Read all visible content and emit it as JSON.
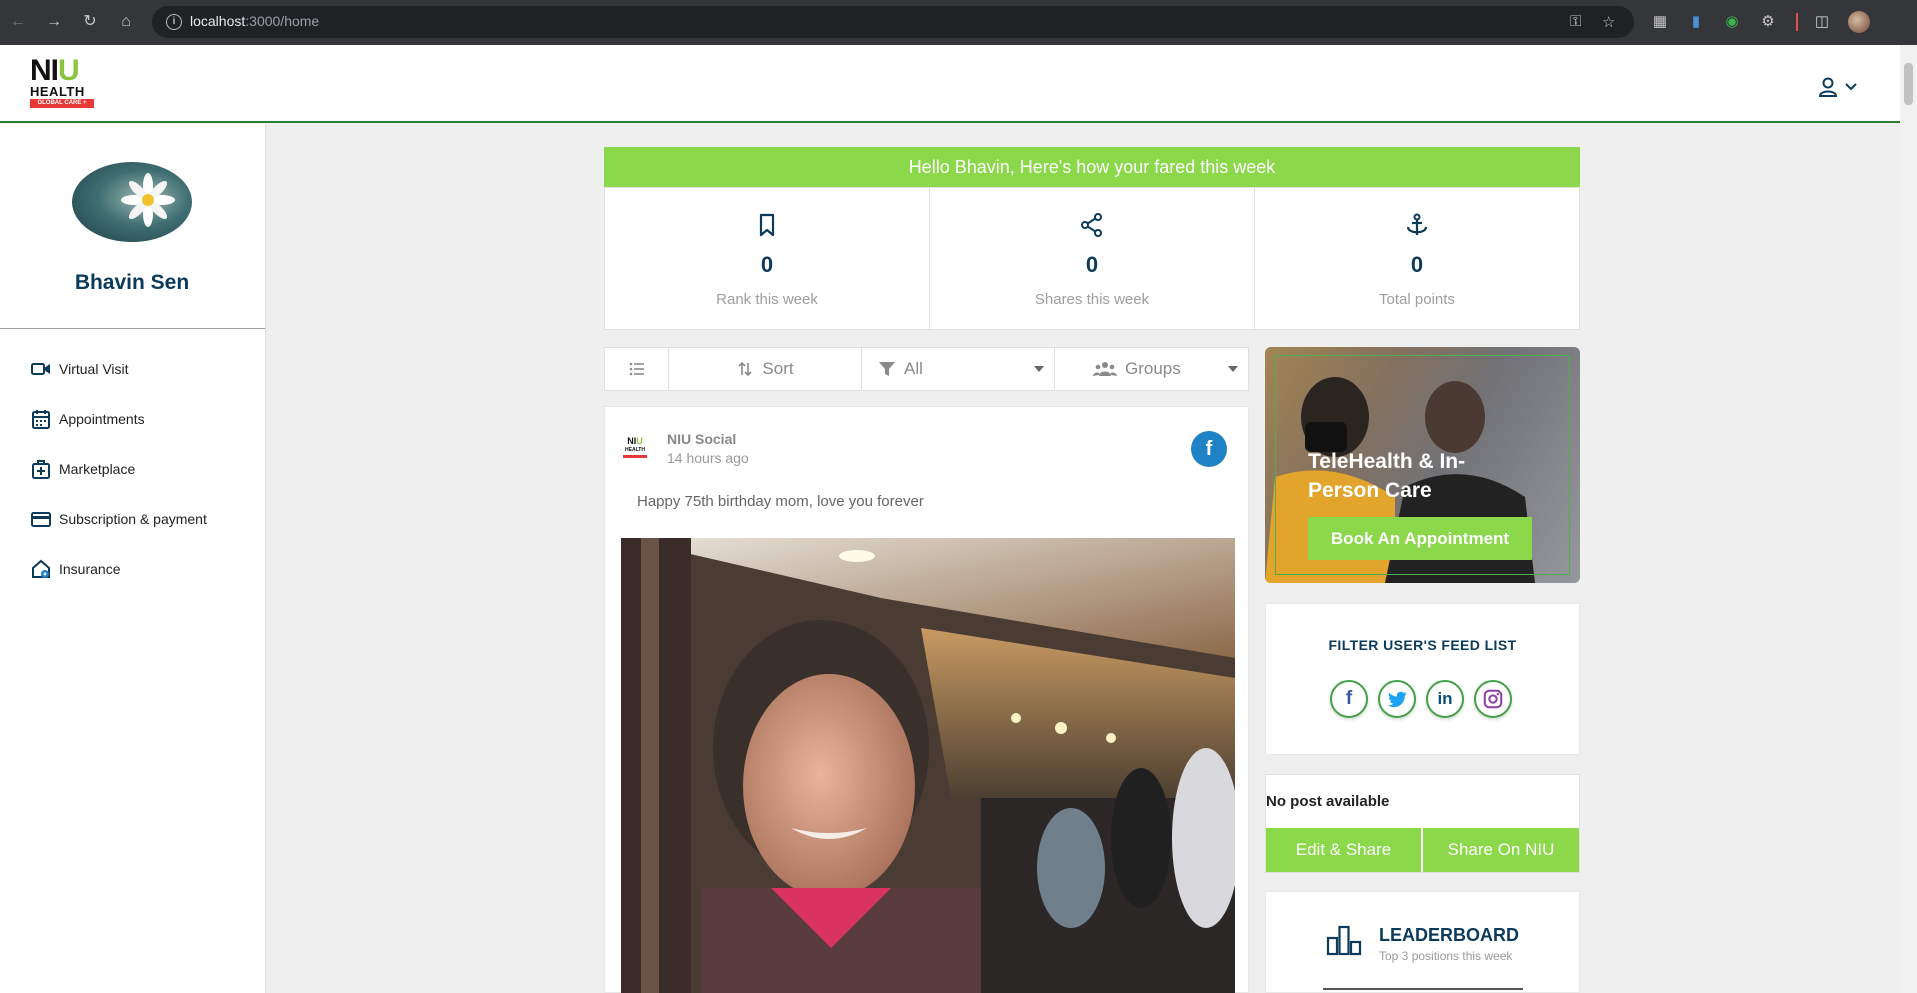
{
  "browser": {
    "url_host": "localhost",
    "url_path": ":3000/home"
  },
  "logo": {
    "mark_n": "NI",
    "mark_u": "U",
    "health": "HEALTH",
    "tag": "GLOBAL CARE +"
  },
  "profile": {
    "name": "Bhavin Sen"
  },
  "sidebar": {
    "items": [
      {
        "label": "Virtual Visit",
        "icon": "video-camera-icon"
      },
      {
        "label": "Appointments",
        "icon": "calendar-icon"
      },
      {
        "label": "Marketplace",
        "icon": "medical-bag-icon"
      },
      {
        "label": "Subscription & payment",
        "icon": "credit-card-icon"
      },
      {
        "label": "Insurance",
        "icon": "home-shield-icon"
      }
    ]
  },
  "banner": {
    "text": "Hello Bhavin, Here's how your fared this week"
  },
  "stats": [
    {
      "value": "0",
      "label": "Rank this week",
      "icon": "bookmark-icon"
    },
    {
      "value": "0",
      "label": "Shares this week",
      "icon": "share-icon"
    },
    {
      "value": "0",
      "label": "Total points",
      "icon": "anchor-icon"
    }
  ],
  "toolbar": {
    "list_icon": "list-icon",
    "sort_label": "Sort",
    "filter_label": "All",
    "groups_label": "Groups"
  },
  "post": {
    "author": "NIU Social",
    "time": "14 hours ago",
    "text": "Happy 75th birthday mom, love you forever",
    "source_badge": "f"
  },
  "promo": {
    "title": "TeleHealth & In-Person Care",
    "button": "Book An Appointment"
  },
  "filter": {
    "title": "FILTER USER'S FEED LIST",
    "networks": [
      {
        "glyph": "f",
        "color": "#3b5998"
      },
      {
        "glyph": "t",
        "color": "#1da1f2"
      },
      {
        "glyph": "in",
        "color": "#0e4d7a"
      },
      {
        "glyph": "ig",
        "color": "#8e3fa8"
      }
    ]
  },
  "share_panel": {
    "empty_text": "No post available",
    "edit_share": "Edit & Share",
    "share_niu": "Share On NIU"
  },
  "leaderboard": {
    "title": "LEADERBOARD",
    "subtitle": "Top 3 positions this week"
  },
  "colors": {
    "brand_green": "#8bd84a",
    "brand_navy": "#0b3a5b",
    "facebook_blue": "#1f82c4"
  }
}
